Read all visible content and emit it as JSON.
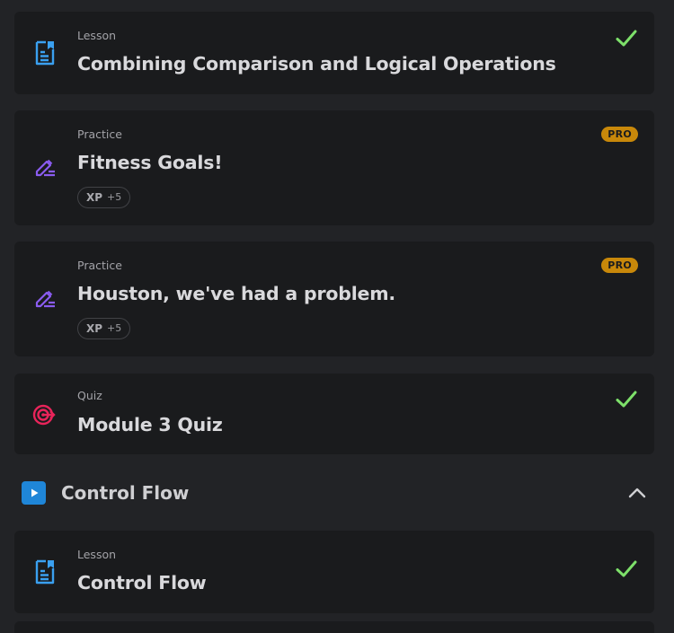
{
  "items": [
    {
      "type": "Lesson",
      "title": "Combining Comparison and Logical Operations",
      "icon": "lesson-icon",
      "status": "completed"
    },
    {
      "type": "Practice",
      "title": "Fitness Goals!",
      "icon": "practice-pencil-icon",
      "badge": "PRO",
      "xp_label": "XP",
      "xp_value": "+5"
    },
    {
      "type": "Practice",
      "title": "Houston, we've had a problem.",
      "icon": "practice-pencil-icon",
      "badge": "PRO",
      "xp_label": "XP",
      "xp_value": "+5"
    },
    {
      "type": "Quiz",
      "title": "Module 3 Quiz",
      "icon": "quiz-target-icon",
      "status": "completed"
    }
  ],
  "section": {
    "title": "Control Flow",
    "icon": "play-icon",
    "toggle_icon": "chevron-up-icon"
  },
  "section_items": [
    {
      "type": "Lesson",
      "title": "Control Flow",
      "icon": "lesson-icon",
      "status": "completed"
    }
  ],
  "colors": {
    "background": "#222326",
    "card": "#1a1b1d",
    "lesson_icon": "#3aa0f0",
    "practice_icon": "#8a5cf0",
    "quiz_icon": "#e8245a",
    "check": "#7de06a",
    "pro_badge": "#c8880a",
    "section_icon": "#1f86d8"
  }
}
